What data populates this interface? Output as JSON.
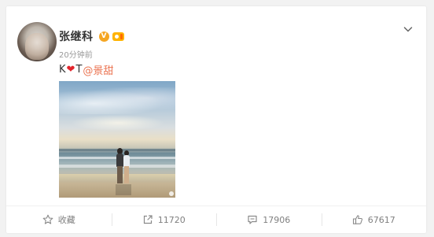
{
  "post": {
    "author": "张继科",
    "verified_mark": "V",
    "time": "20分钟前",
    "text_prefix": "K",
    "text_heart": "❤",
    "text_suffix": "T",
    "mention": "@景甜",
    "image_alt": "couple-on-beach-photo"
  },
  "actions": {
    "favorite_label": "收藏",
    "repost_count": "11720",
    "comment_count": "17906",
    "like_count": "67617"
  },
  "icons": {
    "favorite": "star-icon",
    "repost": "repost-icon",
    "comment": "comment-icon",
    "like": "thumbs-up-icon",
    "menu": "chevron-down-icon"
  },
  "colors": {
    "mention": "#eb7350",
    "heart": "#e3242b",
    "verified": "#f5a623"
  }
}
